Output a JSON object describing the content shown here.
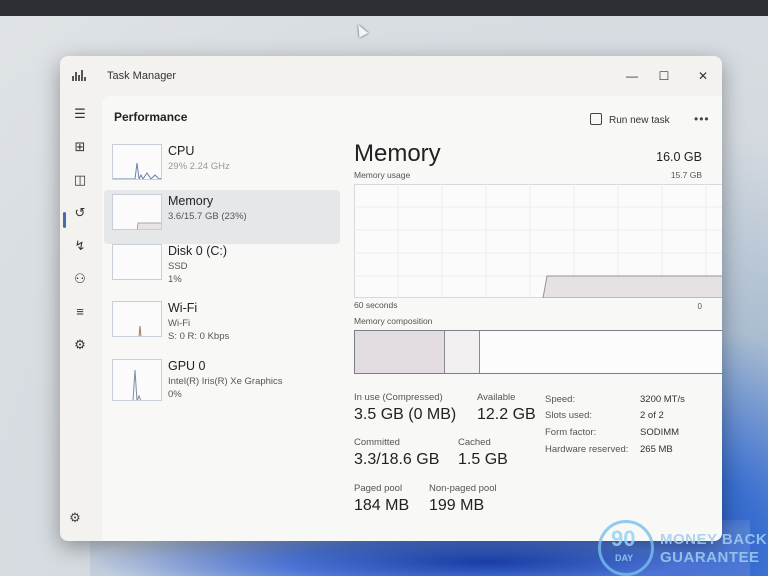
{
  "window": {
    "title": "Task Manager",
    "minimize_glyph": "—",
    "maximize_glyph": "☐",
    "close_glyph": "✕"
  },
  "nav": {
    "items": [
      {
        "icon": "hamburger-menu-icon",
        "glyph": "☰"
      },
      {
        "icon": "processes-icon",
        "glyph": "⊞"
      },
      {
        "icon": "performance-icon",
        "glyph": "◫"
      },
      {
        "icon": "app-history-icon",
        "glyph": "↺"
      },
      {
        "icon": "startup-apps-icon",
        "glyph": "↯"
      },
      {
        "icon": "users-icon",
        "glyph": "⚇"
      },
      {
        "icon": "details-icon",
        "glyph": "≡"
      },
      {
        "icon": "services-icon",
        "glyph": "⚙"
      }
    ],
    "settings_glyph": "⚙"
  },
  "header": {
    "page_title": "Performance",
    "run_new_task": "Run new task",
    "more": "•••"
  },
  "resources": [
    {
      "name": "CPU",
      "line1": "29% 2.24 GHz",
      "line2": ""
    },
    {
      "name": "Memory",
      "line1": "3.6/15.7 GB (23%)",
      "line2": ""
    },
    {
      "name": "Disk 0 (C:)",
      "line1": "SSD",
      "line2": "1%"
    },
    {
      "name": "Wi-Fi",
      "line1": "Wi-Fi",
      "line2": "S: 0 R: 0 Kbps"
    },
    {
      "name": "GPU 0",
      "line1": "Intel(R) Iris(R) Xe Graphics",
      "line2": "0%"
    }
  ],
  "memory": {
    "title": "Memory",
    "total": "16.0 GB",
    "usage_label": "Memory usage",
    "usage_max": "15.7 GB",
    "time_label": "60 seconds",
    "zero_label": "0",
    "usage_fraction": 0.23,
    "composition_label": "Memory composition",
    "composition": {
      "in_use_fraction": 0.23,
      "modified_fraction": 0.09
    },
    "stats": {
      "in_use_label": "In use (Compressed)",
      "in_use_value": "3.5 GB (0 MB)",
      "available_label": "Available",
      "available_value": "12.2 GB",
      "committed_label": "Committed",
      "committed_value": "3.3/18.6 GB",
      "cached_label": "Cached",
      "cached_value": "1.5 GB",
      "paged_label": "Paged pool",
      "paged_value": "184 MB",
      "nonpaged_label": "Non-paged pool",
      "nonpaged_value": "199 MB"
    },
    "specs": {
      "speed_label": "Speed:",
      "speed_value": "3200 MT/s",
      "slots_label": "Slots used:",
      "slots_value": "2 of 2",
      "form_label": "Form factor:",
      "form_value": "SODIMM",
      "hw_label": "Hardware reserved:",
      "hw_value": "265 MB"
    }
  },
  "watermark": {
    "number": "90",
    "day": "DAY",
    "line1": "MONEY BACK",
    "line2": "GUARANTEE"
  },
  "colors": {
    "accent": "#4a6ab0",
    "graph_border": "#c9cfd8",
    "memory_fill": "#e3dce0"
  }
}
